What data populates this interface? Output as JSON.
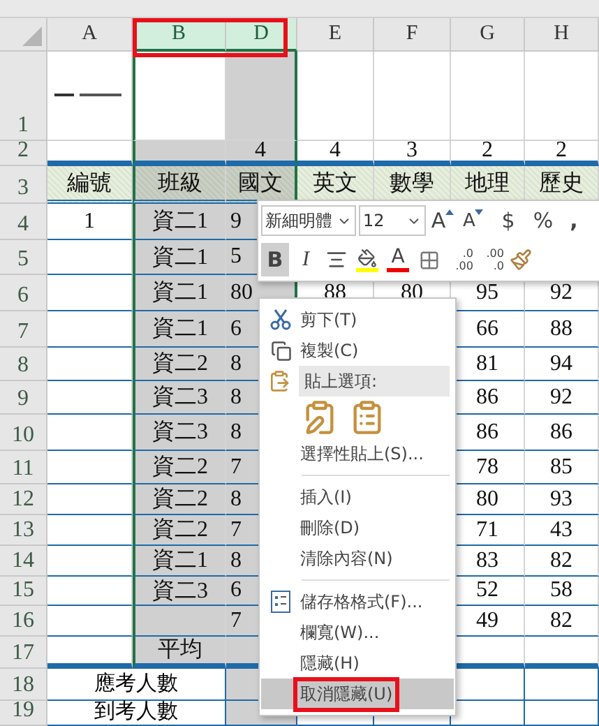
{
  "columns": [
    {
      "label": "A",
      "selected": false
    },
    {
      "label": "B",
      "selected": true
    },
    {
      "label": "D",
      "selected": true
    },
    {
      "label": "E",
      "selected": false
    },
    {
      "label": "F",
      "selected": false
    },
    {
      "label": "G",
      "selected": false
    },
    {
      "label": "H",
      "selected": false
    }
  ],
  "rows": [
    {
      "number": "1",
      "kind": "title"
    },
    {
      "number": "2",
      "kind": "plain",
      "d": "4",
      "e": "4",
      "f": "3",
      "g": "2",
      "h": "2"
    },
    {
      "number": "3",
      "kind": "header",
      "a": "編號",
      "b": "班級",
      "d": "國文",
      "e": "英文",
      "f": "數學",
      "g": "地理",
      "h": "歷史"
    },
    {
      "number": "4",
      "kind": "data",
      "a": "1",
      "b": "資二1",
      "d": "9"
    },
    {
      "number": "5",
      "kind": "data",
      "b": "資二1",
      "d": "5"
    },
    {
      "number": "6",
      "kind": "data",
      "b": "資二1",
      "d": "80",
      "e": "88",
      "f": "80",
      "g": "95",
      "h": "92"
    },
    {
      "number": "7",
      "kind": "data",
      "b": "資二1",
      "d": "6",
      "g": "66",
      "h": "88"
    },
    {
      "number": "8",
      "kind": "data",
      "b": "資二2",
      "d": "8",
      "g": "81",
      "h": "94"
    },
    {
      "number": "9",
      "kind": "data",
      "b": "資二3",
      "d": "8",
      "g": "86",
      "h": "92"
    },
    {
      "number": "10",
      "kind": "data",
      "b": "資二3",
      "d": "8",
      "g": "86",
      "h": "86"
    },
    {
      "number": "11",
      "kind": "data",
      "b": "資二2",
      "d": "7",
      "g": "78",
      "h": "85"
    },
    {
      "number": "12",
      "kind": "data",
      "b": "資二2",
      "d": "8",
      "g": "80",
      "h": "93"
    },
    {
      "number": "13",
      "kind": "data",
      "b": "資二2",
      "d": "7",
      "g": "71",
      "h": "43"
    },
    {
      "number": "14",
      "kind": "data",
      "b": "資二1",
      "d": "8",
      "g": "83",
      "h": "82"
    },
    {
      "number": "15",
      "kind": "data",
      "b": "資二3",
      "d": "6",
      "g": "52",
      "h": "58"
    },
    {
      "number": "16",
      "kind": "data",
      "d": "7",
      "g": "49",
      "h": "82"
    },
    {
      "number": "17",
      "kind": "footer",
      "b": "平均"
    },
    {
      "number": "18",
      "kind": "merged",
      "ab": "應考人數"
    },
    {
      "number": "19",
      "kind": "merged",
      "ab": "到考人數"
    }
  ],
  "mini_toolbar": {
    "font": "新細明體",
    "size": "12",
    "row1": [
      {
        "kind": "grow",
        "label": "A"
      },
      {
        "kind": "shrink",
        "label": "A"
      },
      {
        "kind": "currency",
        "label": "$"
      },
      {
        "kind": "percent",
        "label": "%"
      },
      {
        "kind": "comma",
        "label": ","
      }
    ],
    "row2": [
      {
        "kind": "bold",
        "label": "B",
        "on": true
      },
      {
        "kind": "italic",
        "label": "I",
        "on": false
      },
      {
        "kind": "align",
        "on": false
      },
      {
        "kind": "fill",
        "on": false
      },
      {
        "kind": "font-color",
        "label": "A",
        "on": false
      },
      {
        "kind": "borders",
        "on": false
      },
      {
        "kind": "inc-decimal",
        "top": ".0",
        "bottom": ".00",
        "on": false
      },
      {
        "kind": "dec-decimal",
        "top": ".00",
        "bottom": ".0",
        "on": false
      },
      {
        "kind": "painter",
        "on": false
      }
    ]
  },
  "context_menu": [
    {
      "kind": "cut",
      "label": "剪下(T)",
      "selected": false
    },
    {
      "kind": "copy",
      "label": "複製(C)",
      "selected": false
    },
    {
      "kind": "heading",
      "label": "貼上選項:"
    },
    {
      "kind": "paste-options"
    },
    {
      "kind": "item",
      "label": "選擇性貼上(S)...",
      "selected": false
    },
    {
      "kind": "divider"
    },
    {
      "kind": "item",
      "label": "插入(I)",
      "selected": false
    },
    {
      "kind": "item",
      "label": "刪除(D)",
      "selected": false
    },
    {
      "kind": "item",
      "label": "清除內容(N)",
      "selected": false
    },
    {
      "kind": "divider"
    },
    {
      "kind": "format",
      "label": "儲存格格式(F)...",
      "selected": false
    },
    {
      "kind": "item",
      "label": "欄寬(W)...",
      "selected": false
    },
    {
      "kind": "item",
      "label": "隱藏(H)",
      "selected": false
    },
    {
      "kind": "item",
      "label": "取消隱藏(U)",
      "selected": true,
      "flagged": true
    }
  ],
  "column_header_flagged": true
}
